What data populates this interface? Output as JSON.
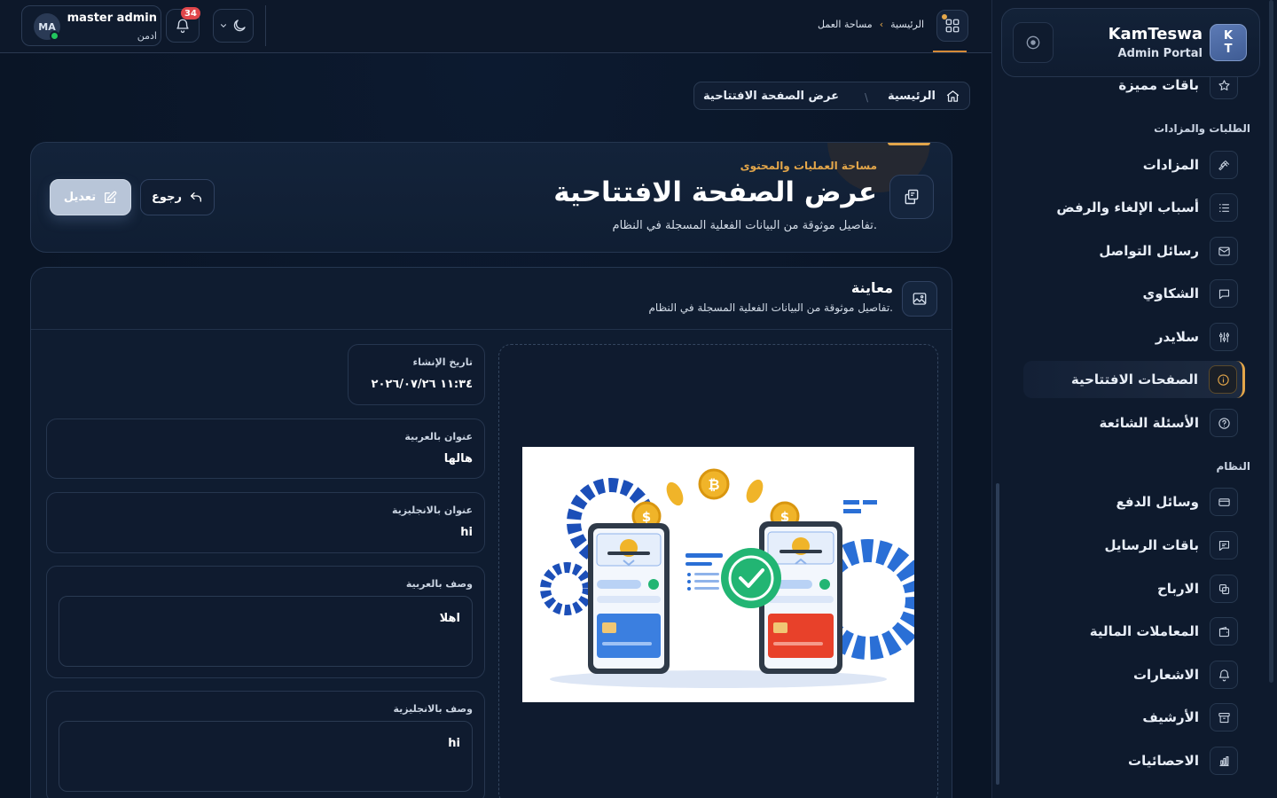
{
  "brand": {
    "name": "KamTeswa",
    "subtitle": "Admin Portal",
    "logo_top": "K",
    "logo_bottom": "T"
  },
  "sidebar": {
    "items": [
      {
        "label": "باقات مميزة",
        "icon": "star-icon"
      },
      {
        "label": "المزادات",
        "icon": "gavel-icon"
      },
      {
        "label": "أسباب الإلغاء والرفض",
        "icon": "list-icon"
      },
      {
        "label": "رسائل التواصل",
        "icon": "mail-icon"
      },
      {
        "label": "الشكاوي",
        "icon": "chat-icon"
      },
      {
        "label": "سلايدر",
        "icon": "sliders-icon"
      },
      {
        "label": "الصفحات الافتتاحية",
        "icon": "info-icon",
        "active": true
      },
      {
        "label": "الأسئلة الشائعة",
        "icon": "help-icon"
      },
      {
        "label": "وسائل الدفع",
        "icon": "card-icon"
      },
      {
        "label": "باقات الرسايل",
        "icon": "message-icon"
      },
      {
        "label": "الارباح",
        "icon": "coins-icon"
      },
      {
        "label": "المعاملات المالية",
        "icon": "wallet-icon"
      },
      {
        "label": "الاشعارات",
        "icon": "bell-icon"
      },
      {
        "label": "الأرشيف",
        "icon": "archive-icon"
      },
      {
        "label": "الاحصائيات",
        "icon": "chart-icon"
      }
    ],
    "sections": {
      "orders": "الطلبات والمزادات",
      "system": "النظام"
    }
  },
  "topbar": {
    "user_name": "master admin",
    "user_role": "ادمن",
    "avatar_initials": "MA",
    "notifications_count": "34",
    "breadcrumb_home": "الرئيسية",
    "breadcrumb_current": "مساحة العمل"
  },
  "page": {
    "breadcrumb_home": "الرئيسية",
    "breadcrumb_current": "عرض الصفحة الافتتاحية",
    "kicker": "مساحة العمليات والمحتوى",
    "title": "عرض الصفحة الافتتاحية",
    "subtitle": "تفاصيل موثوقة من البيانات الفعلية المسجلة في النظام.",
    "back_label": "رجوع",
    "edit_label": "تعديل"
  },
  "preview": {
    "title": "معاينة",
    "subtitle": "تفاصيل موثوقة من البيانات الفعلية المسجلة في النظام."
  },
  "fields": {
    "created_label": "تاريخ الإنشاء",
    "created_value": "١١:٣٤ ٢٠٢٦/٠٧/٢٦",
    "title_ar_label": "عنوان بالعربية",
    "title_ar_value": "هالها",
    "title_en_label": "عنوان بالانجليزية",
    "title_en_value": "hi",
    "desc_ar_label": "وصف بالعربية",
    "desc_ar_value": "اهلا",
    "desc_en_label": "وصف بالانجليزية",
    "desc_en_value": "hi"
  },
  "colors": {
    "accent": "#e3a64a",
    "background": "#0b1628",
    "online": "#22c55e",
    "badge": "#e0464b"
  }
}
